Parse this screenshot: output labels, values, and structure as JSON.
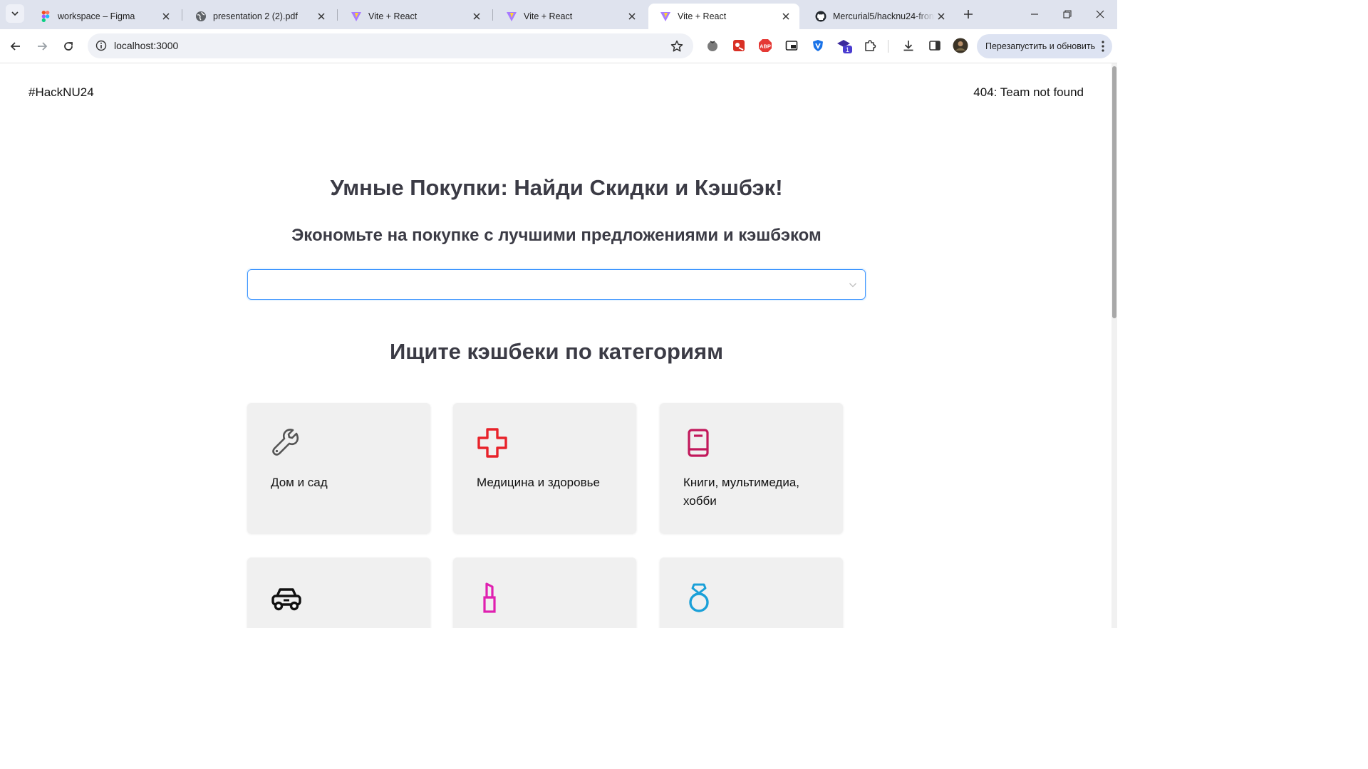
{
  "browser": {
    "tabs": [
      {
        "title": "workspace – Figma",
        "favicon": "figma-icon"
      },
      {
        "title": "presentation 2 (2).pdf",
        "favicon": "globe-icon"
      },
      {
        "title": "Vite + React",
        "favicon": "vite-icon"
      },
      {
        "title": "Vite + React",
        "favicon": "vite-icon"
      },
      {
        "title": "Vite + React",
        "favicon": "vite-icon",
        "active": true
      },
      {
        "title": "Mercurial5/hacknu24-front",
        "favicon": "github-icon"
      }
    ],
    "url": "localhost:3000",
    "relaunch_label": "Перезапустить и обновить",
    "extension_badge": "1"
  },
  "header": {
    "brand": "#HackNU24",
    "team": "404: Team not found"
  },
  "hero": {
    "title": "Умные Покупки: Найди Скидки и Кэшбэк!",
    "subtitle": "Экономьте на покупке с лучшими предложениями и кэшбэком",
    "select_value": ""
  },
  "categories": {
    "title": "Ищите кэшбеки по категориям",
    "items": [
      {
        "label": "Дом и сад",
        "icon": "wrench-icon",
        "color": "#555555"
      },
      {
        "label": "Медицина и здоровье",
        "icon": "medical-cross-icon",
        "color": "#e8222a"
      },
      {
        "label": "Книги, мультимедиа, хобби",
        "icon": "book-icon",
        "color": "#c2185b"
      },
      {
        "label": "",
        "icon": "car-icon",
        "color": "#111111"
      },
      {
        "label": "",
        "icon": "lipstick-icon",
        "color": "#e020b0"
      },
      {
        "label": "",
        "icon": "ring-icon",
        "color": "#1aa0d8"
      }
    ]
  }
}
